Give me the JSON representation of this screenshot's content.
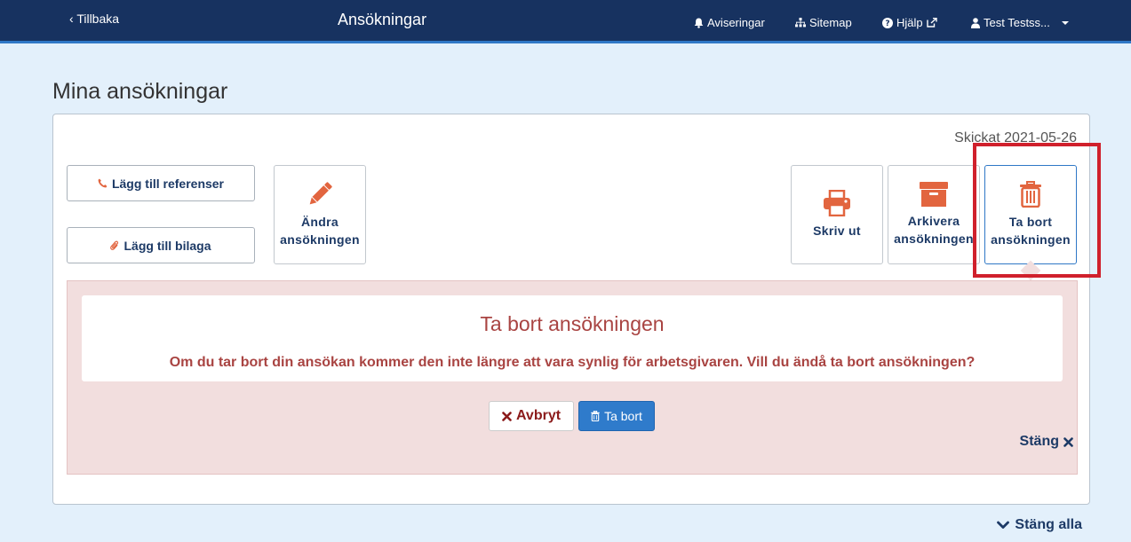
{
  "header": {
    "back_label": "Tillbaka",
    "title": "Ansökningar",
    "notifications_label": "Aviseringar",
    "sitemap_label": "Sitemap",
    "help_label": "Hjälp",
    "user_label": "Test Testss..."
  },
  "page": {
    "title": "Mina ansökningar",
    "sent_label": "Skickat 2021-05-26"
  },
  "actions": {
    "add_references_label": "Lägg till referenser",
    "add_attachment_label": "Lägg till bilaga",
    "edit_label_line1": "Ändra",
    "edit_label_line2": "ansökningen",
    "print_label": "Skriv ut",
    "archive_label_line1": "Arkivera",
    "archive_label_line2": "ansökningen",
    "delete_label_line1": "Ta bort",
    "delete_label_line2": "ansökningen"
  },
  "confirm": {
    "title": "Ta bort ansökningen",
    "message": "Om du tar bort din ansökan kommer den inte längre att vara synlig för arbetsgivaren. Vill du ändå ta bort ansökningen?",
    "cancel_label": "Avbryt",
    "delete_label": "Ta bort",
    "close_label": "Stäng"
  },
  "footer": {
    "close_all_label": "Stäng alla"
  },
  "colors": {
    "header_bg": "#173260",
    "accent": "#2f78c6",
    "icon_orange": "#e2653f",
    "danger_text": "#a94442",
    "alert_bg": "#f2dede"
  },
  "icons": {
    "notifications": "bell-icon",
    "sitemap": "sitemap-icon",
    "help": "question-circle-icon",
    "external": "external-link-icon",
    "user": "user-icon",
    "dropdown": "caret-down-icon",
    "references": "phone-icon",
    "attachment": "paperclip-icon",
    "edit": "pencil-icon",
    "print": "printer-icon",
    "archive": "archive-box-icon",
    "delete": "trash-icon",
    "cancel": "times-icon",
    "close": "times-icon",
    "close_all": "chevron-down-icon"
  }
}
